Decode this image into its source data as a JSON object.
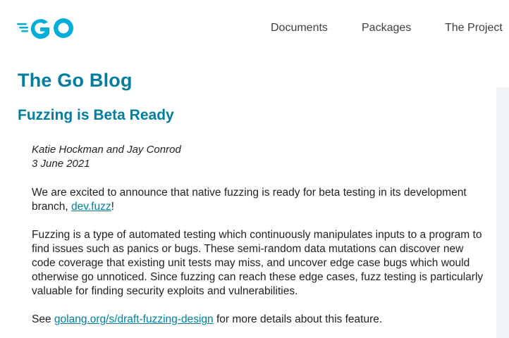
{
  "header": {
    "logo_text": "GO",
    "brand_color": "#00add8",
    "nav": [
      {
        "label": "Documents"
      },
      {
        "label": "Packages"
      },
      {
        "label": "The Project"
      }
    ]
  },
  "blog": {
    "title": "The Go Blog"
  },
  "post": {
    "title": "Fuzzing is Beta Ready",
    "author": "Katie Hockman and Jay Conrod",
    "date": "3 June 2021",
    "p1_text": "We are excited to announce that native fuzzing is ready for beta testing in its development branch, ",
    "p1_link": "dev.fuzz",
    "p1_end": "!",
    "p2_text": "Fuzzing is a type of automated testing which continuously manipulates inputs to a program to find issues such as panics or bugs. These semi-random data mutations can discover new code coverage that existing unit tests may miss, and uncover edge case bugs which would otherwise go unnoticed. Since fuzzing can reach these edge cases, fuzz testing is particularly valuable for finding security exploits and vulnerabilities.",
    "p3_start": "See ",
    "p3_link": "golang.org/s/draft-fuzzing-design",
    "p3_end": " for more details about this feature."
  },
  "colors": {
    "heading": "#007d9c",
    "link": "#007d9c",
    "text": "#202224"
  }
}
